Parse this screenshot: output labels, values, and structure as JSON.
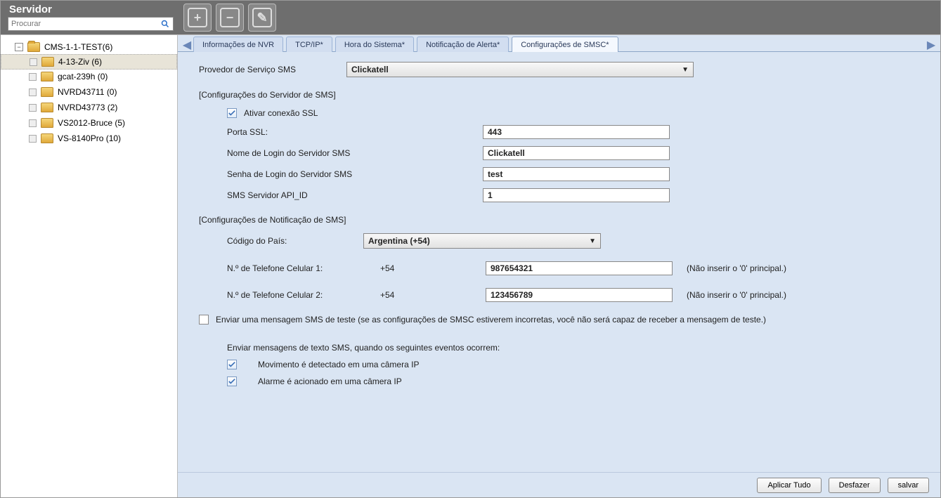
{
  "top": {
    "title": "Servidor",
    "search_placeholder": "Procurar"
  },
  "sidebar": {
    "root": "CMS-1-1-TEST(6)",
    "items": [
      "4-13-Ziv (6)",
      "gcat-239h (0)",
      "NVRD43711 (0)",
      "NVRD43773 (2)",
      "VS2012-Bruce (5)",
      "VS-8140Pro (10)"
    ]
  },
  "tabs": [
    "Informações de NVR",
    "TCP/IP*",
    "Hora do Sistema*",
    "Notificação de Alerta*",
    "Configurações de SMSC*"
  ],
  "active_tab_index": 4,
  "form": {
    "provider_label": "Provedor de Serviço SMS",
    "provider_value": "Clickatell",
    "section_server": "[Configurações do Servidor de SMS]",
    "ssl_enable_label": "Ativar conexão SSL",
    "ssl_port_label": "Porta SSL:",
    "ssl_port_value": "443",
    "login_name_label": "Nome de Login do Servidor SMS",
    "login_name_value": "Clickatell",
    "login_pass_label": "Senha de Login do Servidor SMS",
    "login_pass_value": "test",
    "api_id_label": "SMS Servidor API_ID",
    "api_id_value": "1",
    "section_notify": "[Configurações de Notificação de SMS]",
    "country_label": "Código do País:",
    "country_value": "Argentina (+54)",
    "phone1_label": "N.º de Telefone Celular 1:",
    "phone1_prefix": "+54",
    "phone1_value": "987654321",
    "phone2_label": "N.º de Telefone Celular 2:",
    "phone2_prefix": "+54",
    "phone2_value": "123456789",
    "phone_hint": "(Não inserir o '0' principal.)",
    "test_sms_label": "Enviar uma mensagem SMS de teste (se as configurações de SMSC estiverem incorretas, você não será capaz de receber a mensagem de teste.)",
    "events_intro": "Enviar mensagens de texto SMS, quando os seguintes eventos ocorrem:",
    "event_motion": "Movimento é detectado em uma câmera IP",
    "event_alarm": "Alarme é acionado em uma câmera IP"
  },
  "footer": {
    "apply_all": "Aplicar Tudo",
    "undo": "Desfazer",
    "save": "salvar"
  }
}
